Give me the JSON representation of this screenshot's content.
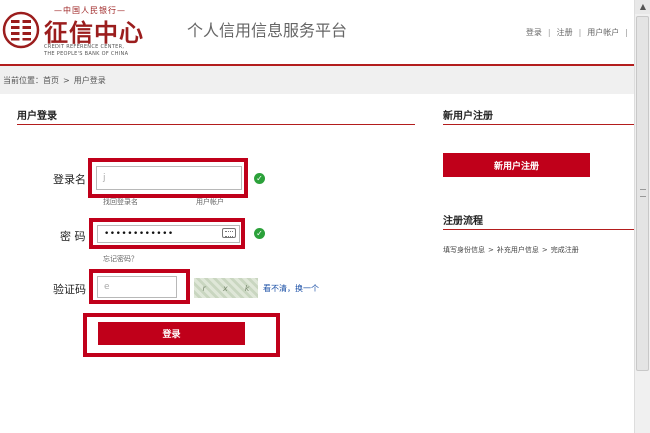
{
  "header": {
    "logo_top": "—中国人民银行—",
    "logo_cn": "征信中心",
    "logo_en1": "CREDIT REFERENCE CENTER,",
    "logo_en2": "THE PEOPLE'S BANK OF CHINA",
    "site_title": "个人信用信息服务平台",
    "nav": [
      "登录",
      "注册",
      "用户帐户"
    ],
    "brand_color": "#b31d1d"
  },
  "breadcrumb": {
    "prefix": "当前位置：",
    "items": [
      "首页",
      "用户登录"
    ],
    "separator": ">"
  },
  "login": {
    "title": "用户登录",
    "username_label": "登录名",
    "username_value": "j",
    "forgot_username": "找回登录名",
    "user_account_hint": "用户帐户",
    "password_label": "密  码",
    "password_value": "••••••••••••",
    "forgot_password": "忘记密码？",
    "captcha_label": "验证码",
    "captcha_value": "e",
    "captcha_refresh": "看不清，换一个",
    "submit_label": "登录",
    "accent": "#c0001a"
  },
  "register": {
    "title": "新用户注册",
    "button_label": "新用户注册",
    "flow_title": "注册流程",
    "flow_steps": [
      "填写身份信息",
      "补充用户信息",
      "完成注册"
    ],
    "flow_separator": ">"
  },
  "icons": {
    "check": "check-icon",
    "keyboard": "keyboard-icon",
    "scroll_up": "scroll-up-arrow-icon"
  }
}
